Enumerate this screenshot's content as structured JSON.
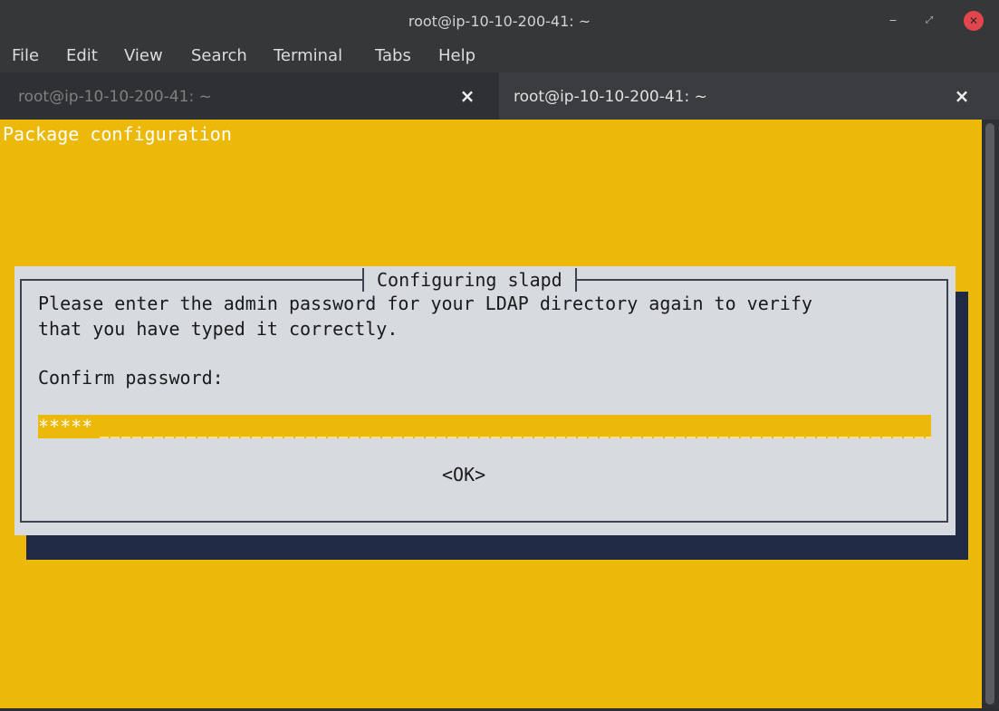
{
  "window": {
    "title": "root@ip-10-10-200-41: ~",
    "controls": {
      "minimize": "‒",
      "maximize": "⤢",
      "close": "✕"
    }
  },
  "menu": [
    "File",
    "Edit",
    "View",
    "Search",
    "Terminal",
    "Tabs",
    "Help"
  ],
  "tabs": [
    {
      "label": "root@ip-10-10-200-41: ~",
      "close": "×",
      "active": false
    },
    {
      "label": "root@ip-10-10-200-41: ~",
      "close": "×",
      "active": true
    }
  ],
  "terminal": {
    "header": "Package configuration",
    "dialog": {
      "title": "Configuring slapd",
      "message_line1": "Please enter the admin password for your LDAP directory again to verify",
      "message_line2": "that you have typed it correctly.",
      "prompt": "Confirm password:",
      "password_value": "*****",
      "ok_label": "<OK>"
    }
  },
  "colors": {
    "terminal_bg": "#ecb90b",
    "dialog_bg": "#d7dadf",
    "dialog_shadow": "#1f2a44",
    "close_button": "#e0464c"
  }
}
